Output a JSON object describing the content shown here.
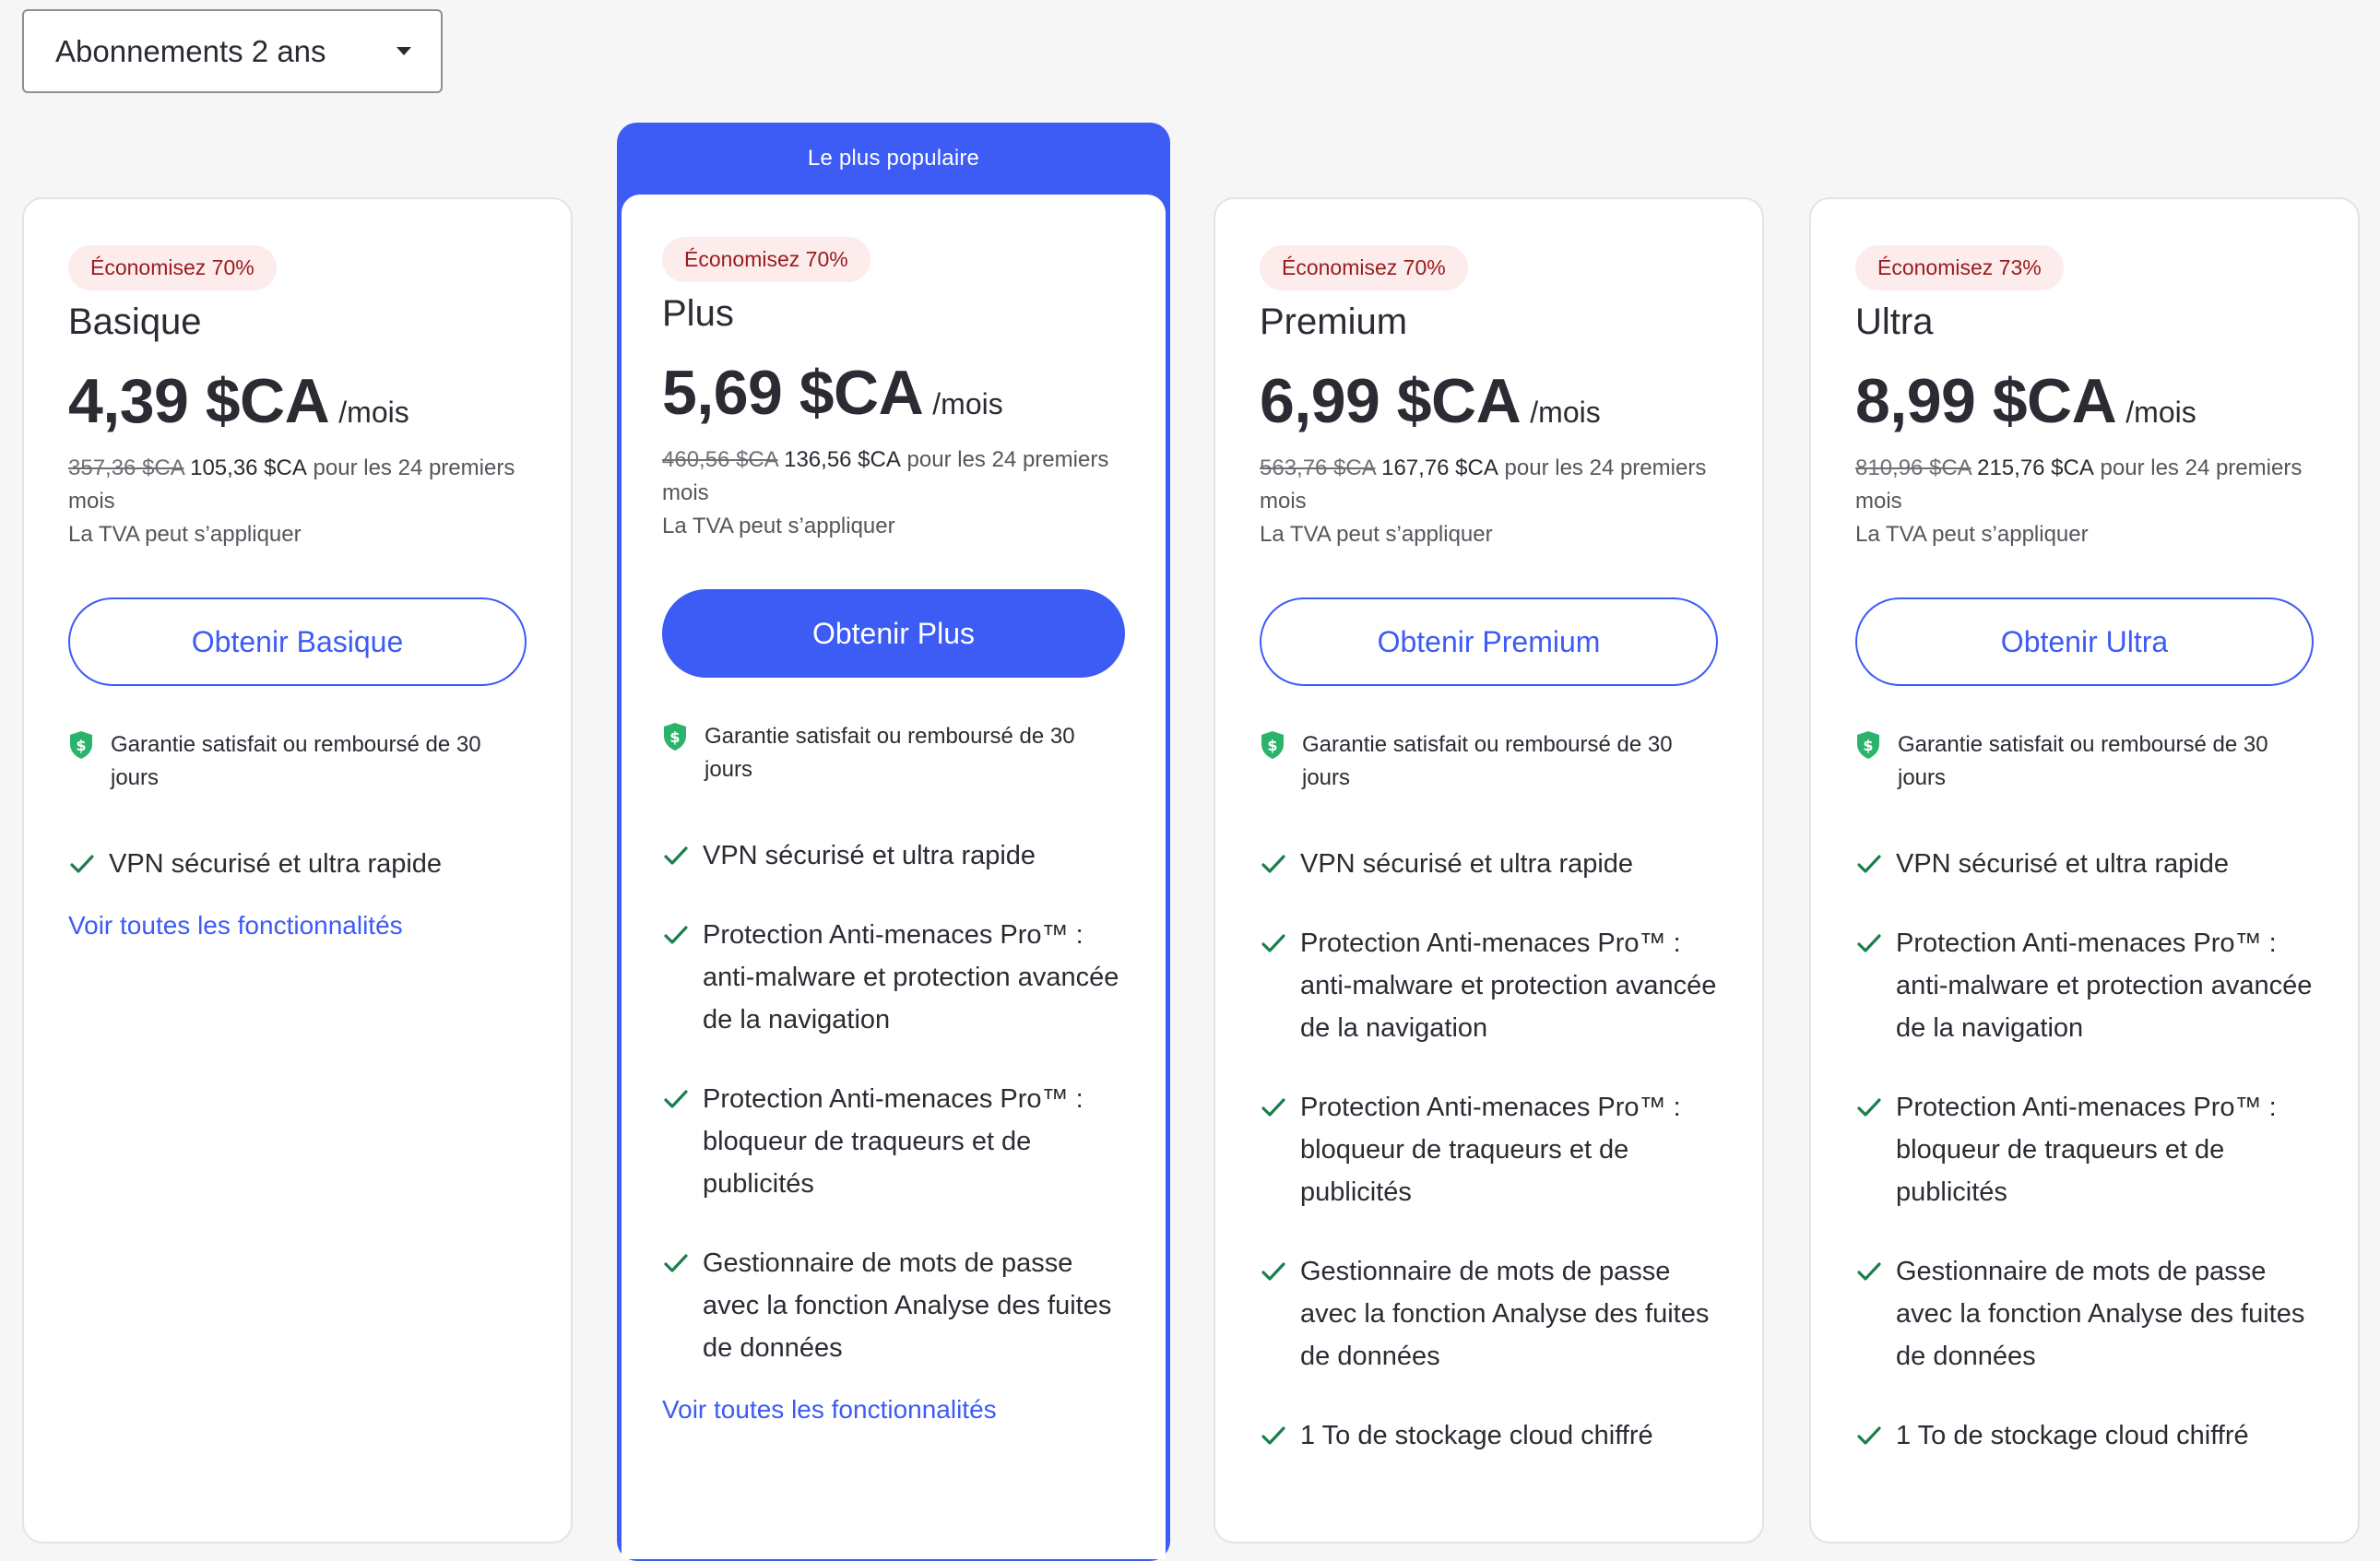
{
  "dropdown": {
    "label": "Abonnements 2 ans"
  },
  "popular_label": "Le plus populaire",
  "common": {
    "per_month": "/mois",
    "period_text": "pour les 24 premiers mois",
    "vat_note": "La TVA peut s’appliquer",
    "guarantee": "Garantie satisfait ou remboursé de 30 jours",
    "see_all": "Voir toutes les fonctionnalités"
  },
  "plans": [
    {
      "badge": "Économisez 70%",
      "name": "Basique",
      "price": "4,39 $CA",
      "old_price": "357,36 $CA",
      "new_price": "105,36 $CA",
      "cta": "Obtenir Basique",
      "features": [
        "VPN sécurisé et ultra rapide"
      ]
    },
    {
      "badge": "Économisez 70%",
      "name": "Plus",
      "price": "5,69 $CA",
      "old_price": "460,56 $CA",
      "new_price": "136,56 $CA",
      "cta": "Obtenir Plus",
      "features": [
        "VPN sécurisé et ultra rapide",
        "Protection Anti-menaces Pro™ : anti-malware et protection avancée de la navigation",
        "Protection Anti-menaces Pro™ : bloqueur de traqueurs et de publicités",
        "Gestionnaire de mots de passe avec la fonction Analyse des fuites de données"
      ]
    },
    {
      "badge": "Économisez 70%",
      "name": "Premium",
      "price": "6,99 $CA",
      "old_price": "563,76 $CA",
      "new_price": "167,76 $CA",
      "cta": "Obtenir Premium",
      "features": [
        "VPN sécurisé et ultra rapide",
        "Protection Anti-menaces Pro™ : anti-malware et protection avancée de la navigation",
        "Protection Anti-menaces Pro™ : bloqueur de traqueurs et de publicités",
        "Gestionnaire de mots de passe avec la fonction Analyse des fuites de données",
        "1 To de stockage cloud chiffré"
      ]
    },
    {
      "badge": "Économisez 73%",
      "name": "Ultra",
      "price": "8,99 $CA",
      "old_price": "810,96 $CA",
      "new_price": "215,76 $CA",
      "cta": "Obtenir Ultra",
      "features": [
        "VPN sécurisé et ultra rapide",
        "Protection Anti-menaces Pro™ : anti-malware et protection avancée de la navigation",
        "Protection Anti-menaces Pro™ : bloqueur de traqueurs et de publicités",
        "Gestionnaire de mots de passe avec la fonction Analyse des fuites de données",
        "1 To de stockage cloud chiffré"
      ]
    }
  ],
  "colors": {
    "accent": "#3d5bf5",
    "badge_bg": "#fcecec",
    "badge_text": "#9b1b1b",
    "check": "#1a7f4b",
    "shield": "#2cb36b"
  }
}
